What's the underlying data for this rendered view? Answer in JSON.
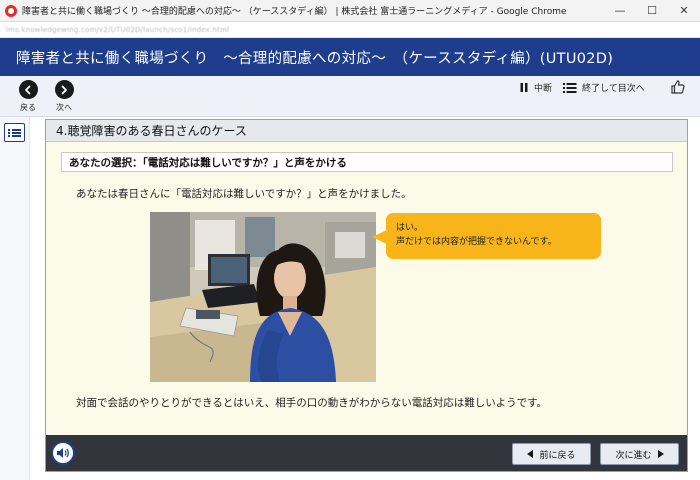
{
  "window": {
    "title": "障害者と共に働く職場づくり ～合理的配慮への対応～ （ケーススタディ編） | 株式会社 富士通ラーニングメディア - Google Chrome",
    "address": "lms.knowledgewing.com/v2/UTU02D/launch/sco1/index.html"
  },
  "course": {
    "title": "障害者と共に働く職場づくり　～合理的配慮への対応～　（ケーススタディ編）(UTU02D)"
  },
  "toolbar": {
    "back_label": "戻る",
    "next_label": "次へ",
    "pause_label": "中断",
    "end_label": "終了して目次へ"
  },
  "content": {
    "section_title": "4.聴覚障害のある春日さんのケース",
    "choice_text": "あなたの選択：「電話対応は難しいですか？」と声をかける",
    "intro_text": "あなたは春日さんに「電話対応は難しいですか？」と声をかけました。",
    "bubble_lines": [
      "はい。",
      "声だけでは内容が把握できないんです。"
    ],
    "outro_text": "対面で会話のやりとりができるとはいえ、相手の口の動きがわからない電話対応は難しいようです。"
  },
  "footer": {
    "prev_label": "前に戻る",
    "next_label": "次に進む"
  },
  "colors": {
    "header_blue": "#1e3d8c",
    "body_cream": "#fcfbe9",
    "bubble_orange": "#f7b519",
    "footer_dark": "#32363c"
  },
  "icons": [
    "app-icon",
    "back-arrow-icon",
    "next-arrow-icon",
    "pause-icon",
    "menu-list-icon",
    "thumbs-up-icon",
    "toc-menu-icon",
    "speaker-icon"
  ]
}
